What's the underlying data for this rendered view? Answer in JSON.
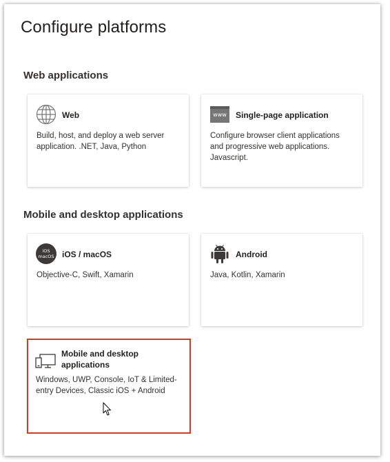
{
  "page": {
    "title": "Configure platforms"
  },
  "sections": [
    {
      "title": "Web applications",
      "cards": [
        {
          "name": "Web",
          "description": "Build, host, and deploy a web server application. .NET, Java, Python",
          "icon": "globe-icon"
        },
        {
          "name": "Single-page application",
          "description": "Configure browser client applications and progressive web applications. Javascript.",
          "icon": "browser-window-icon",
          "icon_text": "www"
        }
      ]
    },
    {
      "title": "Mobile and desktop applications",
      "cards": [
        {
          "name": "iOS / macOS",
          "description": "Objective-C, Swift, Xamarin",
          "icon": "ios-macos-icon",
          "icon_text": [
            "iOS",
            "macOS"
          ]
        },
        {
          "name": "Android",
          "description": "Java, Kotlin, Xamarin",
          "icon": "android-icon"
        },
        {
          "name": "Mobile and desktop applications",
          "description": "Windows, UWP, Console, IoT & Limited-entry Devices, Classic iOS + Android",
          "icon": "desktop-mobile-icon",
          "selected": true
        }
      ]
    }
  ],
  "colors": {
    "selected_border": "#d13b22",
    "text_primary": "#201f1e",
    "icon_gray": "#767676",
    "icon_dark": "#3b3a39"
  }
}
